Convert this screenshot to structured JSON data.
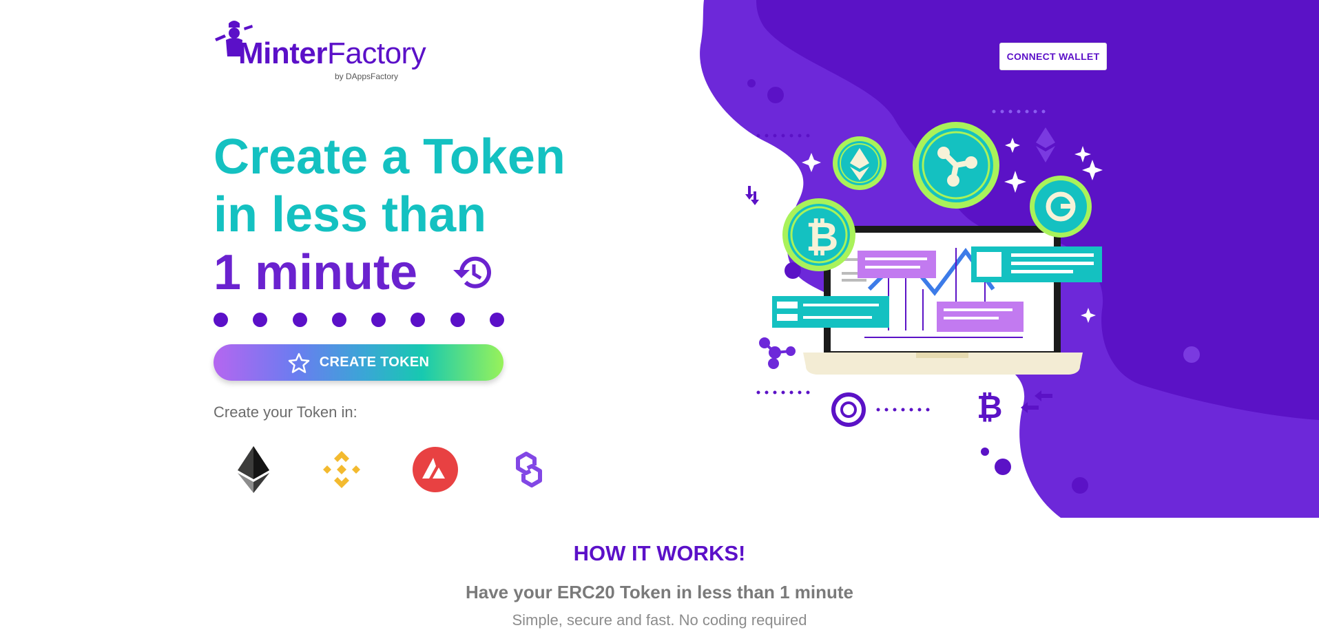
{
  "brand": {
    "logo_bold": "Minter",
    "logo_light": "Factory",
    "logo_sub": "by DAppsFactory",
    "primary_color": "#5b10c8",
    "accent_color": "#14c1c1"
  },
  "header": {
    "connect_label": "CONNECT WALLET"
  },
  "hero": {
    "line1": "Create a Token",
    "line2": "in less than",
    "line3": "1 minute",
    "history_icon": "history-clock-icon",
    "cta_label": "CREATE TOKEN",
    "cta_icon": "star-icon",
    "chains_label": "Create your Token in:",
    "chains": [
      {
        "icon": "ethereum-icon"
      },
      {
        "icon": "binance-icon"
      },
      {
        "icon": "avalanche-icon"
      },
      {
        "icon": "polygon-icon"
      }
    ]
  },
  "how_it_works": {
    "title": "HOW IT WORKS!",
    "subtitle": "Have your ERC20 Token in less than 1 minute",
    "description": "Simple, secure and fast. No coding required"
  }
}
